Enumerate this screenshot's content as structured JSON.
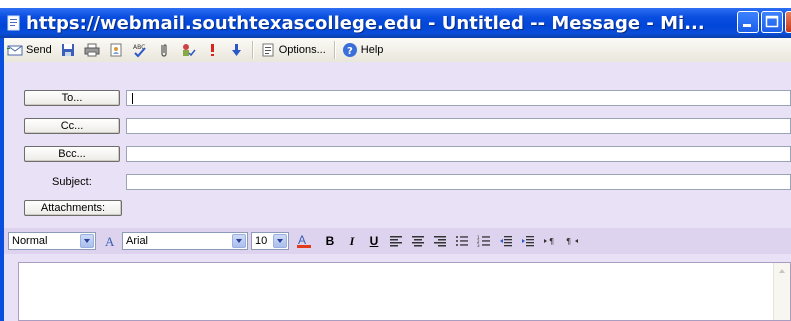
{
  "window": {
    "title": "https://webmail.southtexascollege.edu - Untitled -- Message - Mi..."
  },
  "toolbar": {
    "send_label": "Send",
    "options_label": "Options...",
    "help_label": "Help"
  },
  "compose": {
    "to_label": "To...",
    "cc_label": "Cc...",
    "bcc_label": "Bcc...",
    "subject_label": "Subject:",
    "attachments_label": "Attachments:",
    "to_value": "",
    "cc_value": "",
    "bcc_value": "",
    "subject_value": ""
  },
  "format": {
    "style_value": "Normal",
    "font_value": "Arial",
    "size_value": "10",
    "bold": "B",
    "italic": "I",
    "underline": "U"
  },
  "colors": {
    "titlebar": "#0a4ee0",
    "panel": "#e9e1f5"
  }
}
